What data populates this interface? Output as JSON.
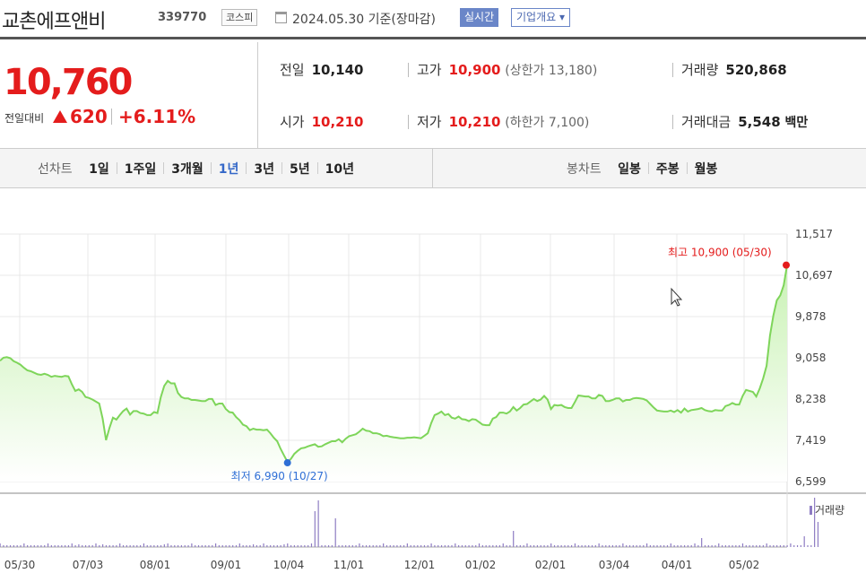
{
  "header": {
    "name": "교촌에프앤비",
    "code": "339770",
    "market": "코스피",
    "date": "2024.05.30 기준(장마감)",
    "realtime_label": "실시간",
    "overview_label": "기업개요 ▾"
  },
  "price": {
    "current": "10,760",
    "prev_label": "전일대비",
    "change": "620",
    "change_pct": "+6.11%"
  },
  "stats": {
    "prev_label": "전일",
    "prev_value": "10,140",
    "high_label": "고가",
    "high_value": "10,900",
    "high_limit": "(상한가 13,180)",
    "volume_label": "거래량",
    "volume_value": "520,868",
    "open_label": "시가",
    "open_value": "10,210",
    "low_label": "저가",
    "low_value": "10,210",
    "low_limit": "(하한가 7,100)",
    "amount_label": "거래대금",
    "amount_value": "5,548",
    "amount_unit": "백만"
  },
  "toolbar": {
    "line_label": "선차트",
    "line_periods": [
      "1일",
      "1주일",
      "3개월",
      "1년",
      "3년",
      "5년",
      "10년"
    ],
    "active_period": "1년",
    "candle_label": "봉차트",
    "candle_periods": [
      "일봉",
      "주봉",
      "월봉"
    ]
  },
  "chart_data": {
    "type": "area",
    "y_ticks": [
      "11,517",
      "10,697",
      "9,878",
      "9,058",
      "8,238",
      "7,419",
      "6,599"
    ],
    "x_ticks": [
      "05/30",
      "07/03",
      "08/01",
      "09/01",
      "10/04",
      "11/01",
      "12/01",
      "01/02",
      "02/01",
      "03/04",
      "04/01",
      "05/02"
    ],
    "ylim": [
      6599,
      11517
    ],
    "max_annotation": "최고 10,900 (05/30)",
    "min_annotation": "최저 6,990 (10/27)",
    "volume_label": "거래량",
    "colors": {
      "line": "#7ed55a",
      "fill_top": "#c9f2b4",
      "fill_bottom": "#ffffff",
      "max_marker": "#e41c1c",
      "min_marker": "#2f6fd6",
      "volume": "#8e7cc3"
    },
    "series": [
      {
        "values": [
          9000,
          9060,
          9070,
          9050,
          8990,
          8960,
          8920,
          8860,
          8810,
          8790,
          8760,
          8730,
          8720,
          8740,
          8720,
          8680,
          8700,
          8690,
          8680,
          8700,
          8690,
          8530,
          8400,
          8430,
          8380,
          8280,
          8260,
          8230,
          8190,
          8150,
          7850,
          7420,
          7670,
          7870,
          7830,
          7920,
          8000,
          8050,
          7930,
          8000,
          8000,
          7960,
          7950,
          7920,
          7920,
          7980,
          7960,
          8280,
          8500,
          8600,
          8550,
          8550,
          8360,
          8280,
          8250,
          8250,
          8220,
          8220,
          8210,
          8200,
          8200,
          8240,
          8240,
          8120,
          8150,
          8150,
          8040,
          7980,
          7970,
          7880,
          7820,
          7730,
          7700,
          7620,
          7650,
          7630,
          7630,
          7620,
          7630,
          7560,
          7470,
          7400,
          7250,
          7120,
          6990,
          7050,
          7150,
          7210,
          7260,
          7270,
          7300,
          7320,
          7340,
          7290,
          7300,
          7340,
          7370,
          7400,
          7400,
          7440,
          7380,
          7450,
          7500,
          7520,
          7540,
          7590,
          7650,
          7610,
          7600,
          7560,
          7560,
          7540,
          7500,
          7510,
          7490,
          7480,
          7470,
          7460,
          7460,
          7470,
          7470,
          7480,
          7470,
          7460,
          7510,
          7560,
          7760,
          7920,
          7950,
          7990,
          7920,
          7940,
          7870,
          7850,
          7890,
          7840,
          7830,
          7800,
          7840,
          7830,
          7780,
          7730,
          7720,
          7720,
          7850,
          7880,
          7970,
          7970,
          7950,
          7990,
          8080,
          8010,
          8060,
          8130,
          8140,
          8190,
          8240,
          8200,
          8230,
          8300,
          8230,
          8040,
          8120,
          8110,
          8120,
          8080,
          8060,
          8060,
          8180,
          8310,
          8300,
          8290,
          8290,
          8250,
          8250,
          8320,
          8300,
          8200,
          8200,
          8220,
          8250,
          8250,
          8190,
          8220,
          8220,
          8250,
          8260,
          8250,
          8240,
          8210,
          8140,
          8070,
          8010,
          8000,
          7990,
          7990,
          8010,
          7980,
          8020,
          7970,
          8050,
          7990,
          8020,
          8030,
          8040,
          8060,
          8020,
          8000,
          7990,
          8020,
          8010,
          8010,
          8100,
          8120,
          8160,
          8130,
          8130,
          8300,
          8420,
          8400,
          8380,
          8290,
          8450,
          8650,
          8900,
          9500,
          9900,
          10200,
          10300,
          10500,
          10900
        ]
      }
    ],
    "volume": [
      2,
      2,
      2,
      2,
      2,
      2,
      2,
      2,
      2,
      2,
      2,
      2,
      2,
      2,
      2,
      2,
      2,
      2,
      2,
      2,
      2,
      2,
      2,
      3,
      2,
      2,
      2,
      2,
      2,
      2,
      3,
      2,
      2,
      2,
      2,
      2,
      2,
      2,
      2,
      2,
      2,
      2,
      2,
      2,
      2,
      2,
      2,
      2,
      3,
      2,
      2,
      2,
      2,
      2,
      2,
      2,
      2,
      2,
      2,
      2,
      2,
      2,
      2,
      2,
      2,
      2,
      2,
      2,
      2,
      2,
      2,
      2,
      2,
      2,
      3,
      2,
      2,
      2,
      2,
      2,
      2,
      2,
      2,
      3,
      2,
      2,
      2,
      2,
      2,
      2,
      2,
      2,
      2,
      2,
      2,
      2,
      2,
      2,
      2,
      2,
      2,
      2,
      2,
      2,
      2,
      2,
      2,
      2,
      2,
      2,
      2,
      2,
      2,
      2,
      2,
      2,
      2,
      2,
      2,
      2,
      2,
      2,
      2,
      2,
      2,
      2,
      2,
      2,
      2,
      2,
      2,
      2,
      2,
      2,
      2,
      2,
      2,
      2,
      2,
      2,
      2,
      2,
      2,
      2,
      2,
      2,
      2,
      2,
      2,
      2,
      2,
      2,
      2,
      2,
      2,
      2,
      2,
      2,
      2,
      2,
      2,
      2,
      2,
      2,
      2,
      2,
      2,
      2,
      2,
      2,
      2,
      2,
      2,
      2,
      2,
      2,
      2,
      2,
      2,
      2,
      2,
      2,
      2,
      2,
      2,
      2,
      2,
      2,
      2,
      2,
      2,
      2,
      2,
      2,
      2,
      2,
      2,
      2,
      2,
      2,
      2,
      2,
      2,
      2,
      2,
      2,
      2,
      2,
      2,
      2,
      2,
      2,
      2,
      2,
      2,
      2,
      2,
      2,
      2,
      2,
      2,
      2,
      2,
      2,
      2,
      2,
      2,
      2,
      2,
      2,
      2,
      2,
      2,
      2,
      2,
      2,
      2,
      2,
      2,
      2
    ]
  }
}
